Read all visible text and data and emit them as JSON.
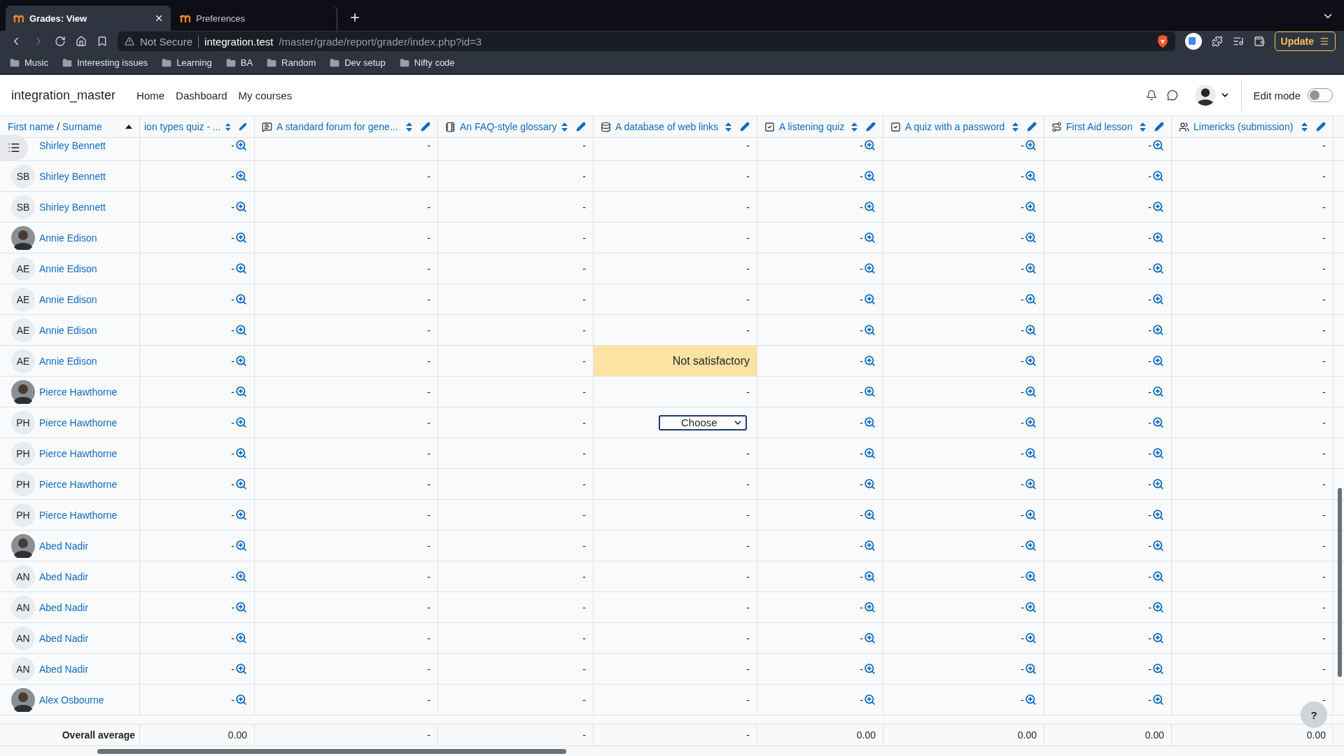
{
  "browser": {
    "tabs": [
      {
        "title": "Grades: View",
        "selected": true
      },
      {
        "title": "Preferences",
        "selected": false
      }
    ],
    "address": {
      "security": "Not Secure",
      "host": "integration.test",
      "path": "/master/grade/report/grader/index.php?id=3"
    },
    "update_button": "Update",
    "bookmarks": [
      "Music",
      "Interesting issues",
      "Learning",
      "BA",
      "Random",
      "Dev setup",
      "Nifty code"
    ]
  },
  "site": {
    "brand": "integration_master",
    "nav": [
      "Home",
      "Dashboard",
      "My courses"
    ],
    "edit_mode": {
      "label": "Edit mode",
      "on": false
    }
  },
  "grader": {
    "name_header": {
      "first": "First name",
      "separator": "/",
      "last": "Surname"
    },
    "columns": [
      {
        "title": "ion types quiz - ...",
        "kind": "quiz",
        "cut": true
      },
      {
        "title": "A standard forum for gene...",
        "kind": "forum",
        "cut": false
      },
      {
        "title": "An FAQ-style glossary",
        "kind": "glossary",
        "cut": false
      },
      {
        "title": "A database of web links",
        "kind": "database",
        "cut": false
      },
      {
        "title": "A listening quiz",
        "kind": "quiz",
        "cut": false
      },
      {
        "title": "A quiz with a password",
        "kind": "quiz",
        "cut": false
      },
      {
        "title": "First Aid lesson",
        "kind": "lesson",
        "cut": false
      },
      {
        "title": "Limericks (submission)",
        "kind": "assign",
        "cut": false
      }
    ],
    "rows": [
      {
        "name": "Shirley Bennett",
        "avatar": {
          "kind": "none"
        },
        "cells": [
          "-",
          "-",
          "-",
          "-",
          "-",
          "-",
          "-",
          "-"
        ]
      },
      {
        "name": "Shirley Bennett",
        "avatar": {
          "kind": "initials",
          "initials": "SB"
        },
        "cells": [
          "-",
          "-",
          "-",
          "-",
          "-",
          "-",
          "-",
          "-"
        ]
      },
      {
        "name": "Shirley Bennett",
        "avatar": {
          "kind": "initials",
          "initials": "SB"
        },
        "cells": [
          "-",
          "-",
          "-",
          "-",
          "-",
          "-",
          "-",
          "-"
        ]
      },
      {
        "name": "Annie Edison",
        "avatar": {
          "kind": "photo"
        },
        "cells": [
          "-",
          "-",
          "-",
          "-",
          "-",
          "-",
          "-",
          "-"
        ]
      },
      {
        "name": "Annie Edison",
        "avatar": {
          "kind": "initials",
          "initials": "AE"
        },
        "cells": [
          "-",
          "-",
          "-",
          "-",
          "-",
          "-",
          "-",
          "-"
        ]
      },
      {
        "name": "Annie Edison",
        "avatar": {
          "kind": "initials",
          "initials": "AE"
        },
        "cells": [
          "-",
          "-",
          "-",
          "-",
          "-",
          "-",
          "-",
          "-"
        ]
      },
      {
        "name": "Annie Edison",
        "avatar": {
          "kind": "initials",
          "initials": "AE"
        },
        "cells": [
          "-",
          "-",
          "-",
          "-",
          "-",
          "-",
          "-",
          "-"
        ]
      },
      {
        "name": "Annie Edison",
        "avatar": {
          "kind": "initials",
          "initials": "AE"
        },
        "cells": [
          "-",
          "-",
          "-",
          {
            "kind": "highlight",
            "value": "Not satisfactory"
          },
          "-",
          "-",
          "-",
          "-"
        ]
      },
      {
        "name": "Pierce Hawthorne",
        "avatar": {
          "kind": "photo"
        },
        "cells": [
          "-",
          "-",
          "-",
          "-",
          "-",
          "-",
          "-",
          "-"
        ]
      },
      {
        "name": "Pierce Hawthorne",
        "avatar": {
          "kind": "initials",
          "initials": "PH"
        },
        "cells": [
          "-",
          "-",
          "-",
          {
            "kind": "select",
            "value": "Choose"
          },
          "-",
          "-",
          "-",
          "-"
        ]
      },
      {
        "name": "Pierce Hawthorne",
        "avatar": {
          "kind": "initials",
          "initials": "PH"
        },
        "cells": [
          "-",
          "-",
          "-",
          "-",
          "-",
          "-",
          "-",
          "-"
        ]
      },
      {
        "name": "Pierce Hawthorne",
        "avatar": {
          "kind": "initials",
          "initials": "PH"
        },
        "cells": [
          "-",
          "-",
          "-",
          "-",
          "-",
          "-",
          "-",
          "-"
        ]
      },
      {
        "name": "Pierce Hawthorne",
        "avatar": {
          "kind": "initials",
          "initials": "PH"
        },
        "cells": [
          "-",
          "-",
          "-",
          "-",
          "-",
          "-",
          "-",
          "-"
        ]
      },
      {
        "name": "Abed Nadir",
        "avatar": {
          "kind": "photo"
        },
        "cells": [
          "-",
          "-",
          "-",
          "-",
          "-",
          "-",
          "-",
          "-"
        ]
      },
      {
        "name": "Abed Nadir",
        "avatar": {
          "kind": "initials",
          "initials": "AN"
        },
        "cells": [
          "-",
          "-",
          "-",
          "-",
          "-",
          "-",
          "-",
          "-"
        ]
      },
      {
        "name": "Abed Nadir",
        "avatar": {
          "kind": "initials",
          "initials": "AN"
        },
        "cells": [
          "-",
          "-",
          "-",
          "-",
          "-",
          "-",
          "-",
          "-"
        ]
      },
      {
        "name": "Abed Nadir",
        "avatar": {
          "kind": "initials",
          "initials": "AN"
        },
        "cells": [
          "-",
          "-",
          "-",
          "-",
          "-",
          "-",
          "-",
          "-"
        ]
      },
      {
        "name": "Abed Nadir",
        "avatar": {
          "kind": "initials",
          "initials": "AN"
        },
        "cells": [
          "-",
          "-",
          "-",
          "-",
          "-",
          "-",
          "-",
          "-"
        ]
      },
      {
        "name": "Alex Osbourne",
        "avatar": {
          "kind": "photo"
        },
        "cells": [
          "-",
          "-",
          "-",
          "-",
          "-",
          "-",
          "-",
          "-"
        ]
      }
    ],
    "footer": {
      "label": "Overall average",
      "values": [
        "0.00",
        "-",
        "-",
        "-",
        "0.00",
        "0.00",
        "0.00",
        "0.00"
      ]
    }
  },
  "help_button": "?"
}
